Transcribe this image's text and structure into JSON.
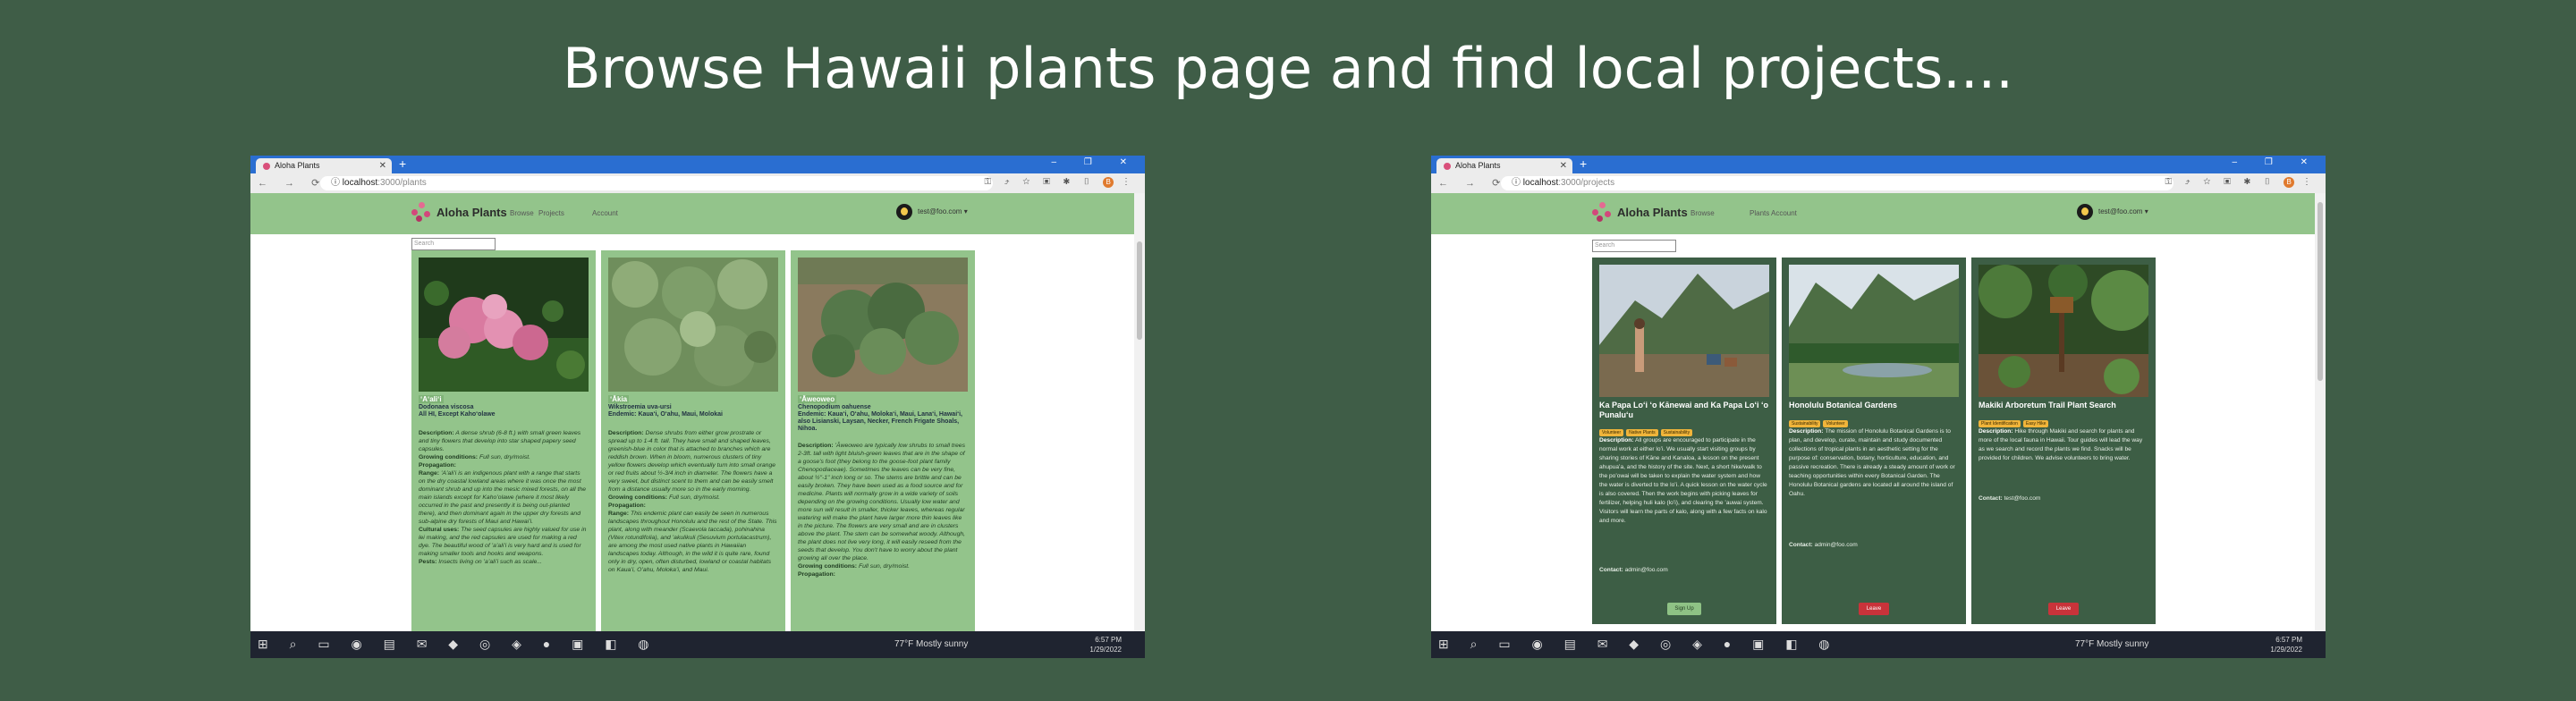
{
  "headline": "Browse Hawaii plants page and find local projects....",
  "browser": {
    "tab_title": "Aloha Plants",
    "new_tab": "+",
    "window_controls": "– ❐ ✕"
  },
  "left": {
    "url_host": "localhost",
    "url_path": ":3000/plants",
    "brand": "Aloha Plants",
    "nav_links": [
      "Browse",
      "Projects",
      "Account"
    ],
    "user": "test@foo.com",
    "search_placeholder": "Search",
    "plants": [
      {
        "name": "ʻAʻaliʻi",
        "scientific": "Dodonaea viscosa",
        "islands": "All HI, Except Kahoʻolawe",
        "description_label": "Description:",
        "description": "A dense shrub (6-8 ft.) with small green leaves and tiny flowers that develop into star shaped papery seed capsules.",
        "conditions_label": "Growing conditions:",
        "conditions": "Full sun, dry/moist.",
        "propagation_label": "Propagation:",
        "range_label": "Range:",
        "range": "ʻAʻaliʻi is an indigenous plant with a range that starts on the dry coastal lowland areas where it was once the most dominant shrub and up into the mesic mixed forests, on all the main islands except for Kahoʻolawe (where it most likely occurred in the past and presently it is being out-planted there), and then dominant again in the upper dry forests and sub-alpine dry forests of Maui and Hawaiʻi.",
        "cultural_label": "Cultural uses:",
        "cultural": "The seed capsules are highly valued for use in lei making, and the red capsules are used for making a red dye. The beautiful wood of ʻaʻaliʻi is very hard and is used for making smaller tools and hooks and weapons.",
        "pests_label": "Pests:",
        "pests": "Insects living on ʻaʻaliʻi such as scale..."
      },
      {
        "name": "ʻĀkia",
        "scientific": "Wikstroemia uva-ursi",
        "islands": "Endemic: Kauaʻi, Oʻahu, Maui, Molokai",
        "description_label": "Description:",
        "description": "Dense shrubs from either grow prostrate or spread up to 1-4 ft. tall. They have small and shaped leaves, greenish-blue in color that is attached to branches which are reddish brown. When in bloom, numerous clusters of tiny yellow flowers develop which eventually turn into small orange or red fruits about ½-3/4 inch in diameter. The flowers have a very sweet, but distinct scent to them and can be easily smelt from a distance usually more so in the early morning.",
        "conditions_label": "Growing conditions:",
        "conditions": "Full sun, dry/moist.",
        "propagation_label": "Propagation:",
        "range_label": "Range:",
        "range": "This endemic plant can easily be seen in numerous landscapes throughout Honolulu and the rest of the State. This plant, along with meander (Scaevola taccada), pohinahina (Vitex rotundifolia), and ʻakulikuli (Sesuvium portulacastrum), are among the most used native plants in Hawaiian landscapes today. Although, in the wild it is quite rare, found only in dry, open, often disturbed, lowland or coastal habitats on Kauaʻi, Oʻahu, Molokaʻi, and Maui."
      },
      {
        "name": "ʻĀweoweo",
        "scientific": "Chenopodium oahuense",
        "islands": "Endemic: Kauaʻi, Oʻahu, Molokaʻi, Maui, Lanaʻi, Hawaiʻi, also Lisianski, Laysan, Necker, French Frigate Shoals, Nihoa.",
        "description_label": "Description:",
        "description": "ʻĀweoweo are typically low shrubs to small trees 2-3ft. tall with light bluish-green leaves that are in the shape of a goose's foot (they belong to the goose-foot plant family Chenopodiaceae). Sometimes the leaves can be very fine, about ½\"-1\" inch long or so. The stems are brittle and can be easily broken. They have been used as a food source and for medicine. Plants will normally grow in a wide variety of soils depending on the growing conditions. Usually low water and more sun will result in smaller, thicker leaves, whereas regular watering will make the plant have larger more thin leaves like in the picture. The flowers are very small and are in clusters above the plant. The stem can be somewhat woody. Although, the plant does not live very long, it will easily reseed from the seeds that develop. You don't have to worry about the plant growing all over the place.",
        "conditions_label": "Growing conditions:",
        "conditions": "Full sun, dry/moist.",
        "propagation_label": "Propagation:"
      }
    ]
  },
  "right": {
    "url_host": "localhost",
    "url_path": ":3000/projects",
    "brand": "Aloha Plants",
    "nav_links": [
      "Browse",
      "Plants",
      "Account"
    ],
    "user": "test@foo.com",
    "search_placeholder": "Search",
    "projects": [
      {
        "title": "Ka Papa Loʻi ʻo Kānewai and Ka Papa Loʻi ʻo Punaluʻu",
        "tags": [
          "Volunteer",
          "Native Plants",
          "Sustainability"
        ],
        "description_label": "Description:",
        "description": "All groups are encouraged to participate in the normal work at either loʻi. We usually start visiting groups by sharing stories of Kāne and Kanaloa, a lesson on the present ahupuaʻa, and the history of the site. Next, a short hike/walk to the poʻowai will be taken to explain the water system and how the water is diverted to the loʻi. A quick lesson on the water cycle is also covered. Then the work begins with picking leaves for fertilizer, helping huli kalo (loʻi), and clearing the ʻauwai system. Visitors will learn the parts of kalo, along with a few facts on kalo and more.",
        "contact_label": "Contact:",
        "contact": "admin@foo.com",
        "button": "Sign Up"
      },
      {
        "title": "Honolulu Botanical Gardens",
        "tags": [
          "Sustainability",
          "Volunteer"
        ],
        "description_label": "Description:",
        "description": "The mission of Honolulu Botanical Gardens is to plan, and develop, curate, maintain and study documented collections of tropical plants in an aesthetic setting for the purpose of: conservation, botany, horticulture, education, and passive recreation. There is already a steady amount of work or teaching opportunities within every Botanical Garden. The Honolulu Botanical gardens are located all around the island of Oahu.",
        "contact_label": "Contact:",
        "contact": "admin@foo.com",
        "button": "Leave"
      },
      {
        "title": "Makiki Arboretum Trail Plant Search",
        "tags": [
          "Plant Identification",
          "Easy Hike"
        ],
        "description_label": "Description:",
        "description": "Hike through Makiki and search for plants and more of the local fauna in Hawaii. Tour guides will lead the way as we search and record the plants we find. Snacks will be provided for children. We advise volunteers to bring water.",
        "contact_label": "Contact:",
        "contact": "test@foo.com",
        "button": "Leave"
      }
    ]
  },
  "taskbar": {
    "weather": "77°F  Mostly sunny",
    "time": "6:57 PM",
    "date": "1/29/2022"
  },
  "colors": {
    "background": "#3f5d47",
    "navbar": "#93c48b",
    "plant_card": "#93c48b",
    "project_card": "#3d5e45",
    "tag": "#f0b43a",
    "signup": "#8fc285",
    "leave": "#c9333a",
    "chrome_tabbar": "#2a6ed1"
  }
}
